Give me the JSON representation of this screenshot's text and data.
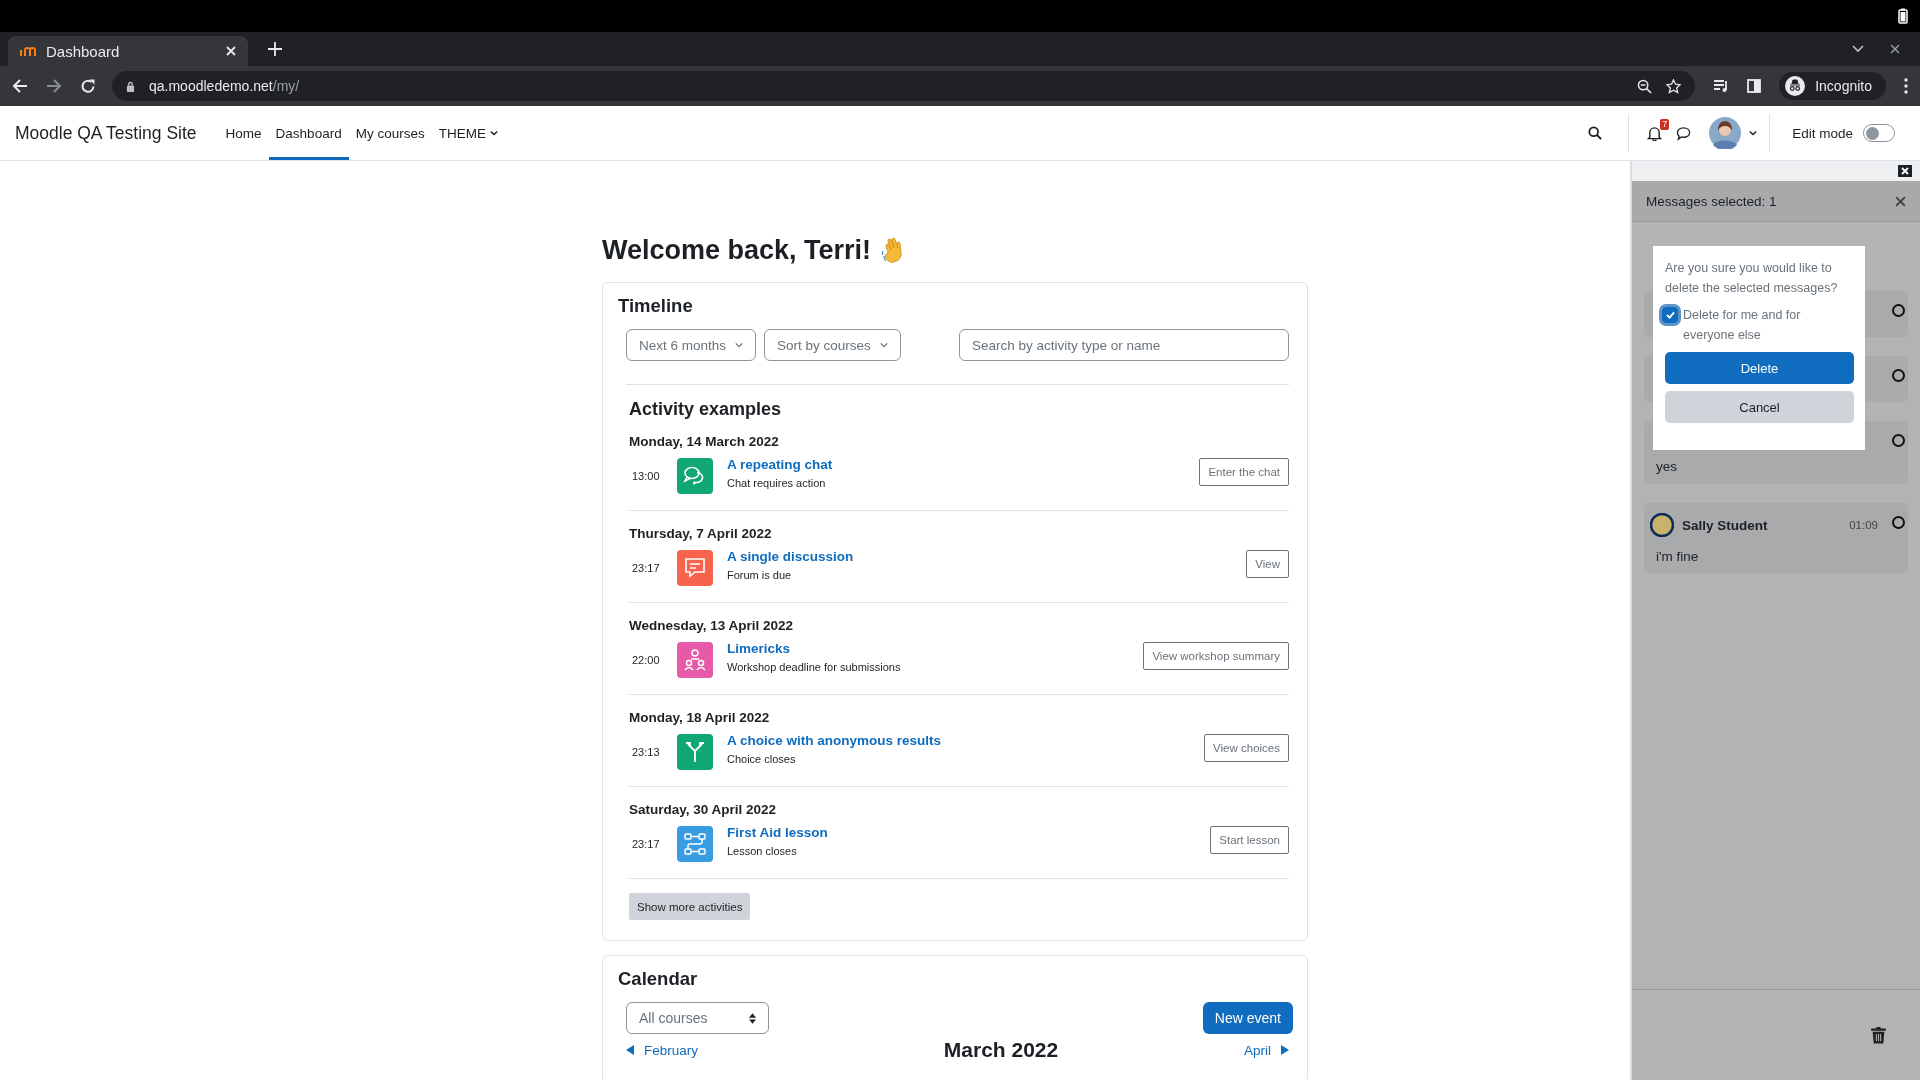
{
  "browser": {
    "tab": {
      "title": "Dashboard"
    },
    "url": {
      "host": "qa.moodledemo.net",
      "path": "/my/"
    },
    "profile": "Incognito"
  },
  "site": {
    "name": "Moodle QA Testing Site",
    "nav": [
      {
        "label": "Home",
        "selected": false,
        "has_menu": false
      },
      {
        "label": "Dashboard",
        "selected": true,
        "has_menu": false
      },
      {
        "label": "My courses",
        "selected": false,
        "has_menu": false
      },
      {
        "label": "THEME",
        "selected": false,
        "has_menu": true
      }
    ],
    "notification_count": "7",
    "edit_mode": {
      "label": "Edit mode",
      "on": false
    }
  },
  "welcome": {
    "heading": "Welcome back, Terri!"
  },
  "timeline": {
    "title": "Timeline",
    "filters": [
      "Next 6 months",
      "Sort by courses"
    ],
    "search": {
      "placeholder": "Search by activity type or name"
    },
    "course": "Activity examples",
    "groups": [
      {
        "date": "Monday, 14 March 2022",
        "items": [
          {
            "time": "13:00",
            "kind": "chat",
            "title": "A repeating chat",
            "subtitle": "Chat requires action",
            "action": "Enter the chat"
          }
        ]
      },
      {
        "date": "Thursday, 7 April 2022",
        "items": [
          {
            "time": "23:17",
            "kind": "forum",
            "title": "A single discussion",
            "subtitle": "Forum is due",
            "action": "View"
          }
        ]
      },
      {
        "date": "Wednesday, 13 April 2022",
        "items": [
          {
            "time": "22:00",
            "kind": "workshop",
            "title": "Limericks",
            "subtitle": "Workshop deadline for submissions",
            "action": "View workshop summary"
          }
        ]
      },
      {
        "date": "Monday, 18 April 2022",
        "items": [
          {
            "time": "23:13",
            "kind": "choice",
            "title": "A choice with anonymous results",
            "subtitle": "Choice closes",
            "action": "View choices"
          }
        ]
      },
      {
        "date": "Saturday, 30 April 2022",
        "items": [
          {
            "time": "23:17",
            "kind": "lesson",
            "title": "First Aid lesson",
            "subtitle": "Lesson closes",
            "action": "Start lesson"
          }
        ]
      }
    ],
    "more": "Show more activities"
  },
  "calendar": {
    "title": "Calendar",
    "course_filter": "All courses",
    "new_event": "New event",
    "previous": "February",
    "month": "March 2022",
    "next": "April"
  },
  "drawer": {
    "header": "Messages selected: 1",
    "messages": [
      {
        "selected": false
      },
      {
        "selected": false
      },
      {
        "text": "yes",
        "selected": false
      },
      {
        "sender": "Sally Student",
        "time": "01:09",
        "text": "i'm fine",
        "selected": false
      }
    ],
    "dialog": {
      "question": "Are you sure you would like to delete the selected messages?",
      "option": {
        "label": "Delete for me and for everyone else",
        "checked": true
      },
      "confirm": "Delete",
      "cancel": "Cancel"
    }
  }
}
